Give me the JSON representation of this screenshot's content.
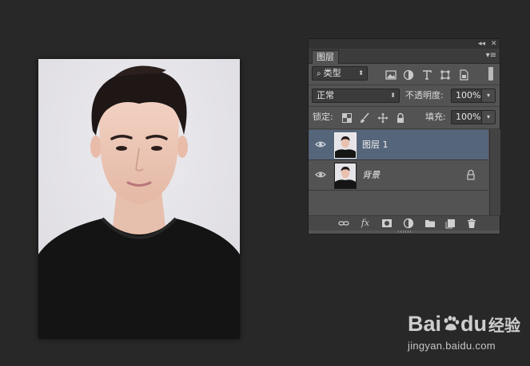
{
  "panel": {
    "topbar": {
      "collapse": "◂◂",
      "close": "✕"
    },
    "tab_label": "图层",
    "menu_icon": "▾≡",
    "filter": {
      "kind_label": "类型",
      "search_icon": "search-icon"
    },
    "blend_mode": "正常",
    "opacity_label": "不透明度:",
    "opacity_value": "100%",
    "lock_label": "锁定:",
    "fill_label": "填充:",
    "fill_value": "100%",
    "layers": [
      {
        "name": "图层 1",
        "selected": true,
        "visible": true,
        "locked": false
      },
      {
        "name": "背景",
        "selected": false,
        "visible": true,
        "locked": true
      }
    ],
    "bottom_icons": {
      "link": "⊖",
      "fx": "fx"
    }
  },
  "watermark": {
    "brand": "Bai",
    "brand2": "du",
    "brand_cn": "经验",
    "url": "jingyan.baidu.com"
  }
}
